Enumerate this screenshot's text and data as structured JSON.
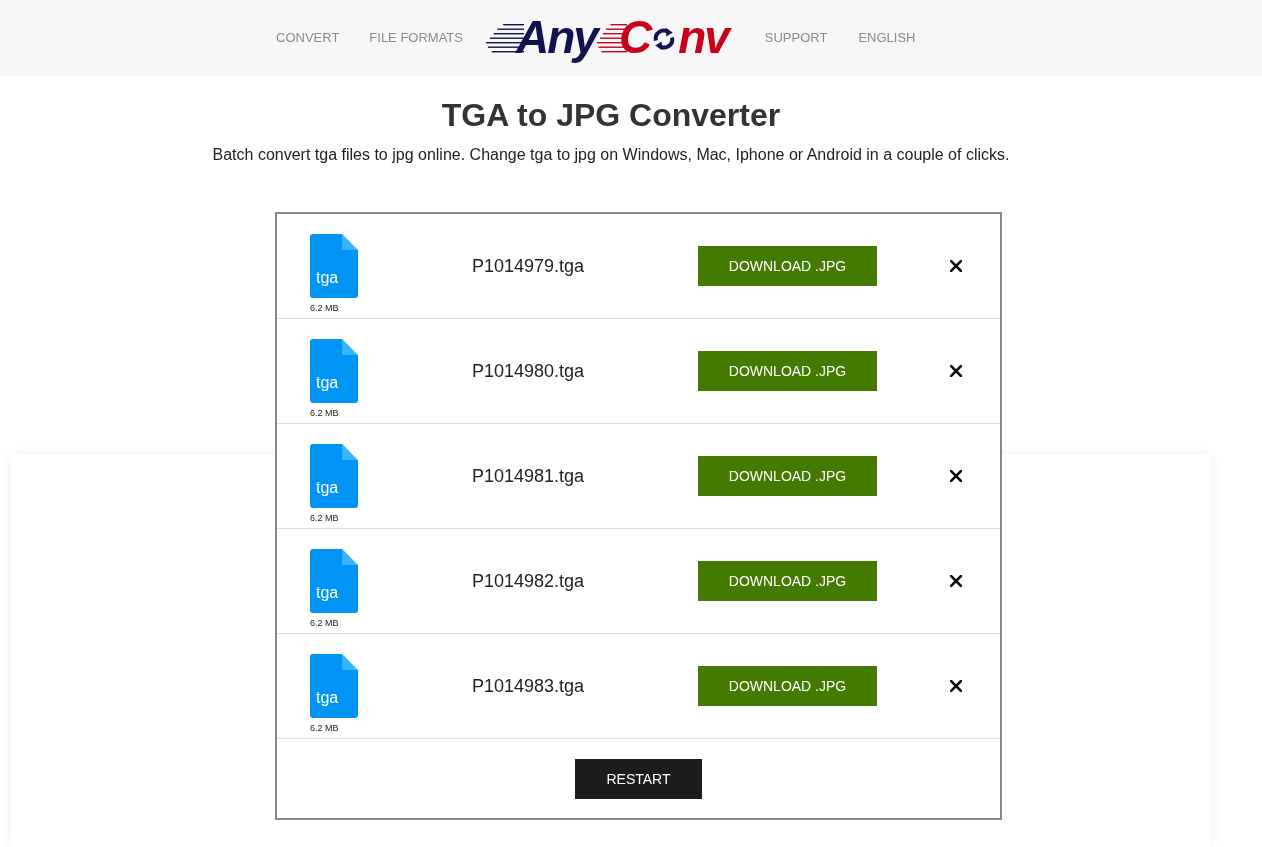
{
  "nav": {
    "left": [
      {
        "label": "CONVERT"
      },
      {
        "label": "FILE FORMATS"
      }
    ],
    "right": [
      {
        "label": "SUPPORT"
      },
      {
        "label": "ENGLISH"
      }
    ]
  },
  "logo": {
    "parts": [
      {
        "text": "Any",
        "color": "#10134d"
      },
      {
        "text": "C",
        "color": "#c8001c"
      },
      {
        "text": "nv",
        "color": "#c8001c"
      }
    ]
  },
  "heading": "TGA to JPG Converter",
  "subtitle": "Batch convert tga files to jpg online. Change tga to jpg on Windows, Mac, Iphone or Android in a couple of clicks.",
  "files": [
    {
      "extension": "tga",
      "size": "6.2 MB",
      "name": "P1014979.tga",
      "download_label": "DOWNLOAD .JPG"
    },
    {
      "extension": "tga",
      "size": "6.2 MB",
      "name": "P1014980.tga",
      "download_label": "DOWNLOAD .JPG"
    },
    {
      "extension": "tga",
      "size": "6.2 MB",
      "name": "P1014981.tga",
      "download_label": "DOWNLOAD .JPG"
    },
    {
      "extension": "tga",
      "size": "6.2 MB",
      "name": "P1014982.tga",
      "download_label": "DOWNLOAD .JPG"
    },
    {
      "extension": "tga",
      "size": "6.2 MB",
      "name": "P1014983.tga",
      "download_label": "DOWNLOAD .JPG"
    }
  ],
  "restart_label": "RESTART"
}
